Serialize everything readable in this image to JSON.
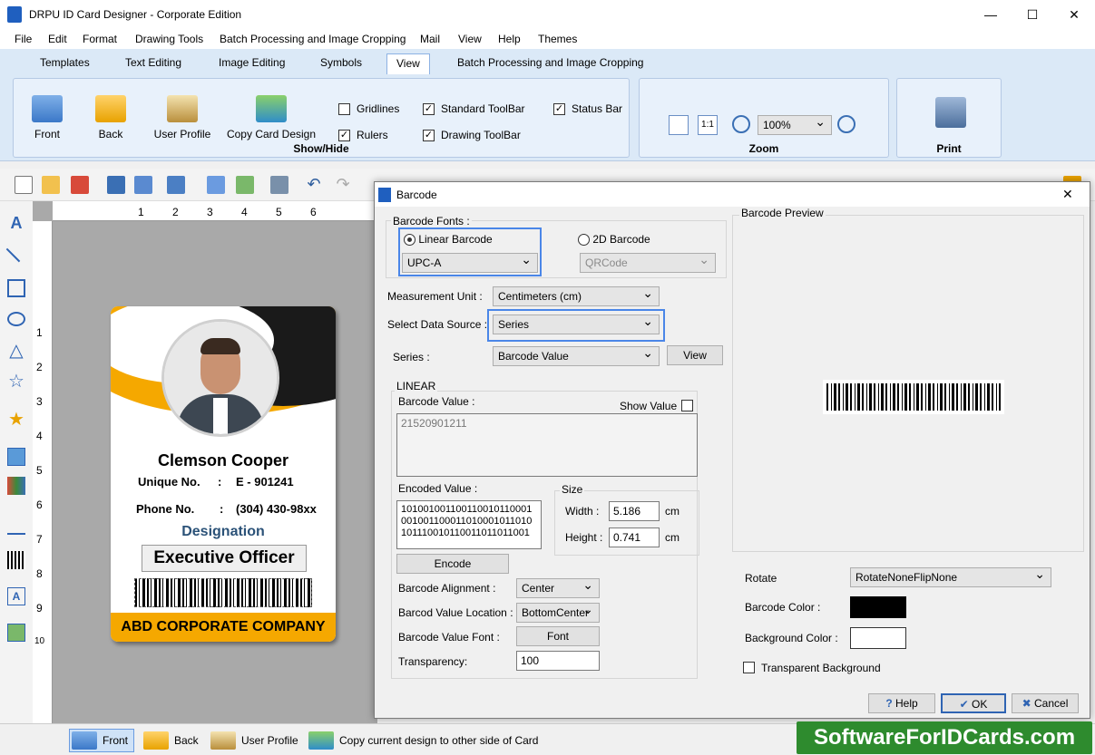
{
  "window": {
    "title": "DRPU ID Card Designer - Corporate Edition",
    "minimize": "—",
    "maximize": "☐",
    "close": "✕"
  },
  "menu": [
    "File",
    "Edit",
    "Format",
    "Drawing Tools",
    "Batch Processing and Image Cropping",
    "Mail",
    "View",
    "Help",
    "Themes"
  ],
  "ribbon_tabs": [
    "Templates",
    "Text Editing",
    "Image Editing",
    "Symbols",
    "View",
    "Batch Processing and Image Cropping"
  ],
  "ribbon": {
    "show_hide": {
      "title": "Show/Hide",
      "buttons": [
        "Front",
        "Back",
        "User Profile",
        "Copy Card Design"
      ],
      "checks": [
        {
          "label": "Gridlines",
          "checked": false
        },
        {
          "label": "Standard ToolBar",
          "checked": true
        },
        {
          "label": "Status Bar",
          "checked": true
        },
        {
          "label": "Rulers",
          "checked": true
        },
        {
          "label": "Drawing ToolBar",
          "checked": true
        }
      ]
    },
    "zoom": {
      "title": "Zoom",
      "fit": "1:1",
      "value": "100%"
    },
    "print": {
      "title": "Print"
    }
  },
  "ruler": {
    "h": [
      "1",
      "2",
      "3",
      "4",
      "5",
      "6"
    ],
    "v": [
      "1",
      "2",
      "3",
      "4",
      "5",
      "6",
      "7",
      "8",
      "9",
      "10"
    ]
  },
  "card": {
    "name": "Clemson Cooper",
    "unique_label": "Unique No.",
    "unique_sep": ":",
    "unique_value": "E - 901241",
    "phone_label": "Phone No.",
    "phone_sep": ":",
    "phone_value": "(304) 430-98xx",
    "designation_label": "Designation",
    "designation_value": "Executive Officer",
    "company": "ABD CORPORATE COMPANY"
  },
  "dialog": {
    "title": "Barcode",
    "close": "✕",
    "barcode_fonts_label": "Barcode Fonts :",
    "linear_label": "Linear Barcode",
    "linear_value": "UPC-A",
    "twod_label": "2D Barcode",
    "twod_value": "QRCode",
    "measurement_label": "Measurement Unit :",
    "measurement_value": "Centimeters (cm)",
    "data_source_label": "Select Data Source :",
    "data_source_value": "Series",
    "series_label": "Series :",
    "series_value": "Barcode Value",
    "view_btn": "View",
    "linear_group": "LINEAR",
    "barcode_value_label": "Barcode Value :",
    "show_value_label": "Show Value",
    "barcode_value": "21520901211",
    "encoded_label": "Encoded Value :",
    "encoded_value": "101001001100110010110001 001001100011010001011010 101110010110011011011001",
    "size_label": "Size",
    "width_label": "Width :",
    "width_value": "5.186",
    "width_unit": "cm",
    "height_label": "Height :",
    "height_value": "0.741",
    "height_unit": "cm",
    "encode_btn": "Encode",
    "alignment_label": "Barcode Alignment :",
    "alignment_value": "Center",
    "value_location_label": "Barcod Value Location :",
    "value_location_value": "BottomCenter",
    "value_font_label": "Barcode Value Font :",
    "font_btn": "Font",
    "transparency_label": "Transparency:",
    "transparency_value": "100",
    "preview_label": "Barcode Preview",
    "rotate_label": "Rotate",
    "rotate_value": "RotateNoneFlipNone",
    "barcode_color_label": "Barcode Color :",
    "barcode_color": "#000000",
    "background_color_label": "Background Color :",
    "background_color": "#ffffff",
    "transparent_bg_label": "Transparent Background",
    "help_btn": "Help",
    "ok_btn": "OK",
    "cancel_btn": "Cancel"
  },
  "statusbar": {
    "front": "Front",
    "back": "Back",
    "user_profile": "User Profile",
    "copy": "Copy current design to other side of Card"
  },
  "watermark": "SoftwareForIDCards.com",
  "colors": {
    "accent": "#f5a800",
    "selection": "#4a86e8",
    "ribbon": "#dbe9f7"
  }
}
